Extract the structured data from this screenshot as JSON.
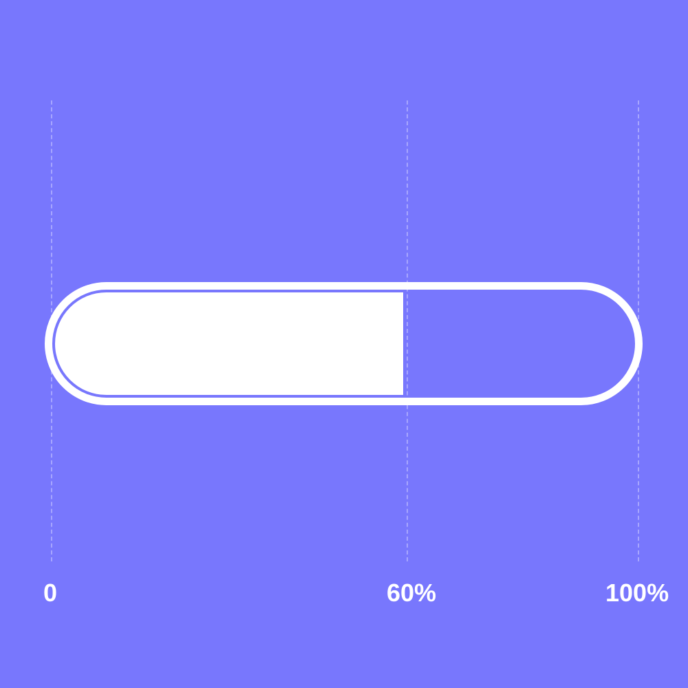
{
  "progress": {
    "value_fraction": 0.6,
    "fill_color": "#FFFFFF",
    "background_color": "#7877FD"
  },
  "scale": {
    "labels": [
      "0",
      "60%",
      "100%"
    ]
  }
}
